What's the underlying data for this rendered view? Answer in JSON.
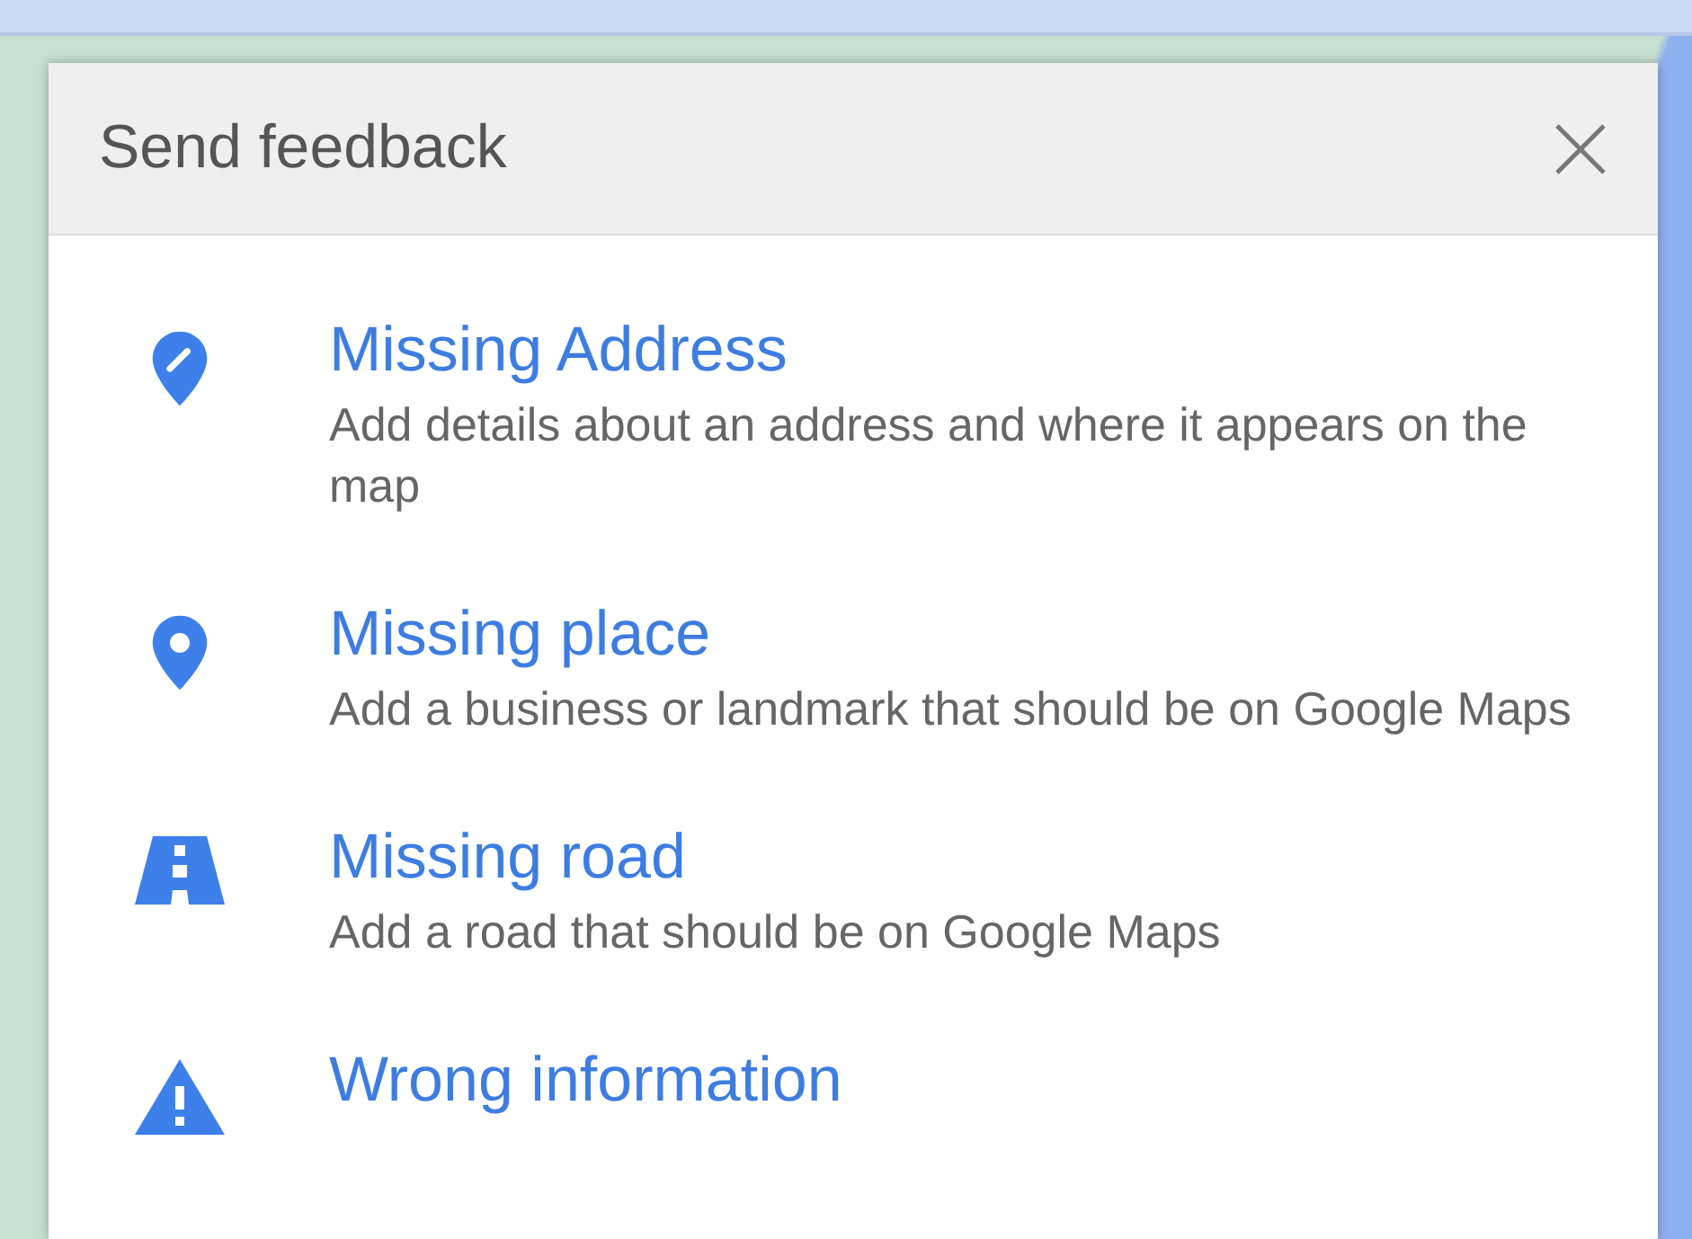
{
  "dialog": {
    "title": "Send feedback"
  },
  "items": [
    {
      "kind": "address",
      "title": "Missing Address",
      "description": "Add details about an address and where it appears on the map"
    },
    {
      "kind": "place",
      "title": "Missing place",
      "description": "Add a business or landmark that should be on Google Maps"
    },
    {
      "kind": "road",
      "title": "Missing road",
      "description": "Add a road that should be on Google Maps"
    },
    {
      "kind": "wrong",
      "title": "Wrong information"
    }
  ]
}
